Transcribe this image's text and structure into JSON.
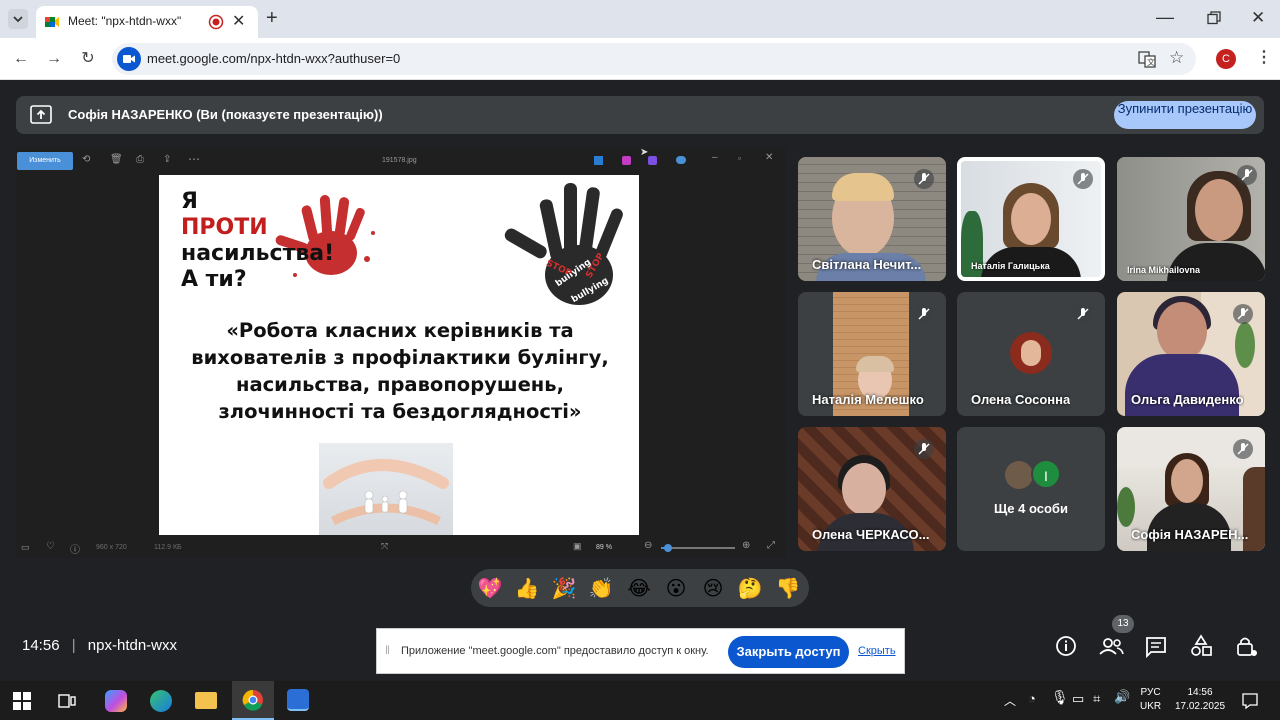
{
  "browser": {
    "tab_title": "Meet: \"npx-htdn-wxx\"",
    "url": "meet.google.com/npx-htdn-wxx?authuser=0",
    "profile_initial": "C",
    "colors": {
      "tabbar": "#dfe3eb",
      "accent": "#0b57d0"
    }
  },
  "presenting": {
    "text": "Софія НАЗАРЕНКО (Ви (показуєте презентацію))",
    "stop_button": "Зупинити презентацію"
  },
  "viewer": {
    "edit_button": "Изменить",
    "file_name": "191578.jpg",
    "dimensions": "960 x 720",
    "file_size": "112.9 КБ",
    "zoom": "89 %",
    "zoom_fraction": 0.1
  },
  "slide": {
    "line1": "Я",
    "line2": "ПРОТИ",
    "line3": "насильства!",
    "line4": "А ти?",
    "title": "«Робота класних керівників та вихователів з профілактики булінгу, насильства, правопорушень, злочинності та бездоглядності»",
    "hand_words": [
      "bullying",
      "STOP",
      "bullying",
      "STOP"
    ]
  },
  "participants": [
    {
      "name": "Світлана Нечит...",
      "muted": true
    },
    {
      "name": "Наталія Галицька",
      "muted": true
    },
    {
      "name": "Irina Mikhailovna",
      "muted": true
    },
    {
      "name": "Наталія Мелешко",
      "muted": true
    },
    {
      "name": "Олена Сосонна",
      "muted": true
    },
    {
      "name": "Ольга Давиденко",
      "muted": true
    },
    {
      "name": "Олена ЧЕРКАСО...",
      "muted": true
    },
    {
      "name": "Ще 4 особи",
      "extra_initial": "I"
    },
    {
      "name": "Софія НАЗАРЕН...",
      "muted": true
    }
  ],
  "reactions": [
    "💖",
    "👍",
    "🎉",
    "👏",
    "😂",
    "😮",
    "😢",
    "🤔",
    "👎"
  ],
  "footer": {
    "time": "14:56",
    "meeting_code": "npx-htdn-wxx",
    "participants_count": "13"
  },
  "share_notice": {
    "text": "Приложение \"meet.google.com\" предоставило доступ к окну.",
    "stop_button": "Закрыть доступ",
    "hide_link": "Скрыть"
  },
  "taskbar": {
    "lang": "РУС",
    "layout": "UKR",
    "time": "14:56",
    "date": "17.02.2025"
  }
}
